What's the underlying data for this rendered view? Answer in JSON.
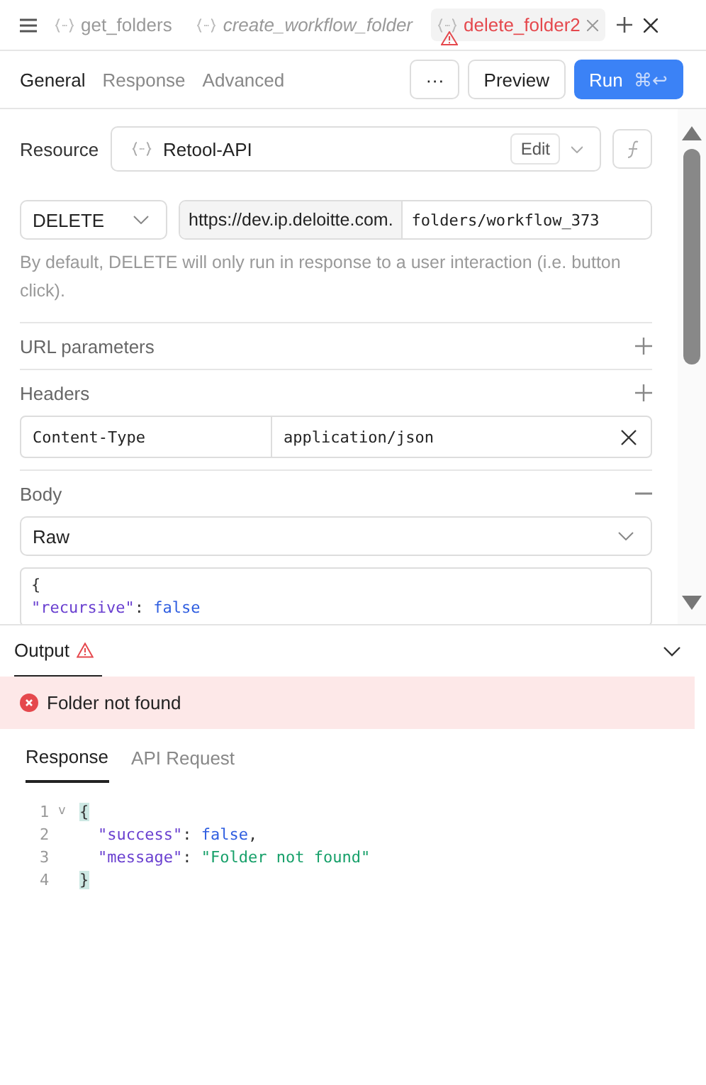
{
  "query_tabs": [
    {
      "label": "get_folders",
      "selected": false,
      "italic": false,
      "error": false
    },
    {
      "label": "create_workflow_folder",
      "selected": false,
      "italic": true,
      "error": false
    },
    {
      "label": "delete_folder2",
      "selected": true,
      "italic": false,
      "error": true
    }
  ],
  "editor_tabs": [
    {
      "label": "General",
      "selected": true
    },
    {
      "label": "Response",
      "selected": false
    },
    {
      "label": "Advanced",
      "selected": false
    }
  ],
  "toolbar": {
    "more": "···",
    "preview": "Preview",
    "run": "Run",
    "run_shortcut": "⌘↩"
  },
  "resource": {
    "label": "Resource",
    "value": "Retool-API",
    "edit": "Edit"
  },
  "request": {
    "method": "DELETE",
    "base_url": "https://dev.ip.deloitte.com.",
    "path": "folders/workflow_373"
  },
  "hint": "By default, DELETE will only run in response to a user interaction (i.e. button click).",
  "url_parameters": {
    "title": "URL parameters"
  },
  "headers": {
    "title": "Headers",
    "rows": [
      {
        "key": "Content-Type",
        "value": "application/json"
      }
    ]
  },
  "body": {
    "title": "Body",
    "type": "Raw",
    "lines": [
      [
        {
          "kind": "punct",
          "text": "{"
        }
      ],
      [
        {
          "kind": "key",
          "text": "\"recursive\""
        },
        {
          "kind": "punct",
          "text": ": "
        },
        {
          "kind": "bool",
          "text": "false"
        }
      ]
    ]
  },
  "output": {
    "title": "Output",
    "error": "Folder not found",
    "tabs": [
      {
        "label": "Response",
        "selected": true
      },
      {
        "label": "API Request",
        "selected": false
      }
    ],
    "lines": [
      {
        "number": "1",
        "fold": "v",
        "indented": false,
        "tokens": [
          {
            "kind": "match",
            "text": "{"
          }
        ]
      },
      {
        "number": "2",
        "indented": true,
        "tokens": [
          {
            "kind": "key",
            "text": "\"success\""
          },
          {
            "kind": "punct",
            "text": ": "
          },
          {
            "kind": "bool",
            "text": "false"
          },
          {
            "kind": "punct",
            "text": ","
          }
        ]
      },
      {
        "number": "3",
        "indented": true,
        "tokens": [
          {
            "kind": "key",
            "text": "\"message\""
          },
          {
            "kind": "punct",
            "text": ": "
          },
          {
            "kind": "string",
            "text": "\"Folder not found\""
          }
        ]
      },
      {
        "number": "4",
        "indented": false,
        "tokens": [
          {
            "kind": "match",
            "text": "}"
          }
        ]
      }
    ]
  }
}
